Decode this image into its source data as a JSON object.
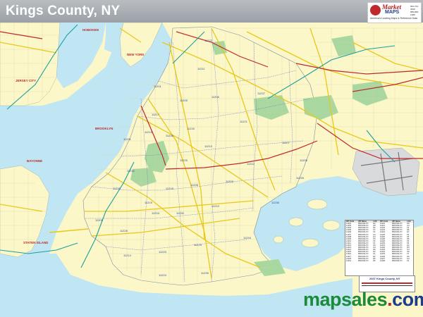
{
  "title": "Kings County, NY",
  "logo": {
    "brand_line1": "Market",
    "brand_line2": "MAPS",
    "tagline": "America's Leading Maps & Reference Data",
    "contact": "800-762-3008 · 888-858-1988"
  },
  "colors": {
    "land": "#fbf7c8",
    "water": "#bfe6f2",
    "park": "#a8d8a0",
    "title_bar": "#a6abb0",
    "major_road": "#e8c81a",
    "highway_red": "#c0282d",
    "rail": "#1aa0a0",
    "zip_boundary": "#6a6ad0",
    "brand_green": "#1b8a3a"
  },
  "places": [
    {
      "name": "HOBOKEN"
    },
    {
      "name": "JERSEY CITY"
    },
    {
      "name": "BROOKLYN"
    },
    {
      "name": "BAYONNE"
    },
    {
      "name": "STATEN ISLAND"
    },
    {
      "name": "NEW YORK"
    }
  ],
  "zip_labels": [
    {
      "zip": "11201"
    },
    {
      "zip": "11231"
    },
    {
      "zip": "11215"
    },
    {
      "zip": "11220"
    },
    {
      "zip": "11209"
    },
    {
      "zip": "11228"
    },
    {
      "zip": "11204"
    },
    {
      "zip": "11214"
    },
    {
      "zip": "11223"
    },
    {
      "zip": "11229"
    },
    {
      "zip": "11235"
    },
    {
      "zip": "11224"
    },
    {
      "zip": "11234"
    },
    {
      "zip": "11236"
    },
    {
      "zip": "11239"
    },
    {
      "zip": "11207"
    },
    {
      "zip": "11208"
    },
    {
      "zip": "11221"
    },
    {
      "zip": "11206"
    },
    {
      "zip": "11211"
    },
    {
      "zip": "11222"
    },
    {
      "zip": "11237"
    },
    {
      "zip": "11213"
    },
    {
      "zip": "11212"
    },
    {
      "zip": "11203"
    },
    {
      "zip": "11226"
    },
    {
      "zip": "11210"
    },
    {
      "zip": "11230"
    },
    {
      "zip": "11218"
    },
    {
      "zip": "11219"
    },
    {
      "zip": "11232"
    },
    {
      "zip": "11225"
    },
    {
      "zip": "11216"
    },
    {
      "zip": "11238"
    },
    {
      "zip": "11217"
    },
    {
      "zip": "11205"
    }
  ],
  "legend": {
    "headers": [
      "ZIP Code",
      "ZIP Name",
      "LOC",
      "ZIP Code",
      "ZIP Name",
      "LOC"
    ],
    "rows": [
      [
        "11201",
        "BROOKLYN",
        "E4",
        "11220",
        "BROOKLYN",
        "D5"
      ],
      [
        "11203",
        "BROOKLYN",
        "G5",
        "11221",
        "BROOKLYN",
        "G4"
      ],
      [
        "11204",
        "BROOKLYN",
        "E6",
        "11222",
        "BROOKLYN",
        "F2"
      ],
      [
        "11205",
        "BROOKLYN",
        "F3",
        "11223",
        "BROOKLYN",
        "E6"
      ],
      [
        "11206",
        "BROOKLYN",
        "F3",
        "11224",
        "BROOKLYN",
        "E7"
      ],
      [
        "11207",
        "BROOKLYN",
        "H4",
        "11225",
        "BROOKLYN",
        "F5"
      ],
      [
        "11208",
        "BROOKLYN",
        "H4",
        "11226",
        "BROOKLYN",
        "F5"
      ],
      [
        "11209",
        "BROOKLYN",
        "C6",
        "11228",
        "BROOKLYN",
        "D6"
      ],
      [
        "11210",
        "BROOKLYN",
        "F6",
        "11229",
        "BROOKLYN",
        "F6"
      ],
      [
        "11211",
        "BROOKLYN",
        "F2",
        "11230",
        "BROOKLYN",
        "F6"
      ],
      [
        "11212",
        "BROOKLYN",
        "G5",
        "11231",
        "BROOKLYN",
        "E4"
      ],
      [
        "11213",
        "BROOKLYN",
        "G4",
        "11232",
        "BROOKLYN",
        "D5"
      ],
      [
        "11214",
        "BROOKLYN",
        "D6",
        "11233",
        "BROOKLYN",
        "G4"
      ],
      [
        "11215",
        "BROOKLYN",
        "E4",
        "11234",
        "BROOKLYN",
        "G6"
      ],
      [
        "11216",
        "BROOKLYN",
        "F4",
        "11235",
        "BROOKLYN",
        "F7"
      ],
      [
        "11217",
        "BROOKLYN",
        "E4",
        "11236",
        "BROOKLYN",
        "H6"
      ],
      [
        "11218",
        "BROOKLYN",
        "E5",
        "11237",
        "BROOKLYN",
        "G3"
      ],
      [
        "11219",
        "BROOKLYN",
        "E5",
        "11238",
        "BROOKLYN",
        "F4"
      ]
    ]
  },
  "footer": {
    "title": "2007 Kings County, NY"
  },
  "watermark": {
    "part1": "mapsales",
    "dot": ".",
    "part2": "com"
  }
}
